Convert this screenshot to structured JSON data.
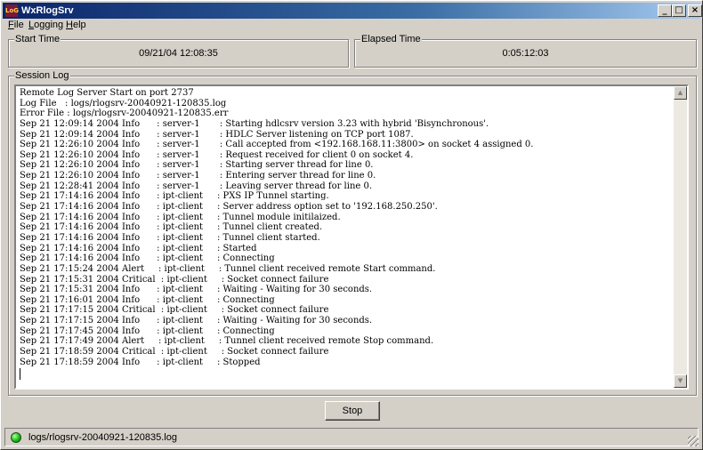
{
  "window": {
    "title": "WxRlogSrv",
    "icon_label": "LoG"
  },
  "menu": [
    {
      "label": "File",
      "mnemonic": "F",
      "rest": "ile"
    },
    {
      "label": "Logging",
      "mnemonic": "L",
      "rest": "ogging"
    },
    {
      "label": "Help",
      "mnemonic": "H",
      "rest": "elp"
    }
  ],
  "start_time": {
    "label": "Start Time",
    "value": "09/21/04 12:08:35"
  },
  "elapsed_time": {
    "label": "Elapsed Time",
    "value": "0:05:12:03"
  },
  "session_log": {
    "label": "Session Log",
    "lines": [
      "Remote Log Server Start on port 2737",
      "Log File   : logs/rlogsrv-20040921-120835.log",
      "Error File : logs/rlogsrv-20040921-120835.err",
      "Sep 21 12:09:14 2004 Info      : server-1       : Starting hdlcsrv version 3.23 with hybrid 'Bisynchronous'.",
      "Sep 21 12:09:14 2004 Info      : server-1       : HDLC Server listening on TCP port 1087.",
      "Sep 21 12:26:10 2004 Info      : server-1       : Call accepted from <192.168.168.11:3800> on socket 4 assigned 0.",
      "Sep 21 12:26:10 2004 Info      : server-1       : Request received for client 0 on socket 4.",
      "Sep 21 12:26:10 2004 Info      : server-1       : Starting server thread for line 0.",
      "Sep 21 12:26:10 2004 Info      : server-1       : Entering server thread for line 0.",
      "Sep 21 12:28:41 2004 Info      : server-1       : Leaving server thread for line 0.",
      "Sep 21 17:14:16 2004 Info      : ipt-client     : PXS IP Tunnel starting.",
      "Sep 21 17:14:16 2004 Info      : ipt-client     : Server address option set to '192.168.250.250'.",
      "Sep 21 17:14:16 2004 Info      : ipt-client     : Tunnel module initilaized.",
      "Sep 21 17:14:16 2004 Info      : ipt-client     : Tunnel client created.",
      "Sep 21 17:14:16 2004 Info      : ipt-client     : Tunnel client started.",
      "Sep 21 17:14:16 2004 Info      : ipt-client     : Started",
      "Sep 21 17:14:16 2004 Info      : ipt-client     : Connecting",
      "Sep 21 17:15:24 2004 Alert     : ipt-client     : Tunnel client received remote Start command.",
      "Sep 21 17:15:31 2004 Critical  : ipt-client     : Socket connect failure",
      "Sep 21 17:15:31 2004 Info      : ipt-client     : Waiting - Waiting for 30 seconds.",
      "Sep 21 17:16:01 2004 Info      : ipt-client     : Connecting",
      "Sep 21 17:17:15 2004 Critical  : ipt-client     : Socket connect failure",
      "Sep 21 17:17:15 2004 Info      : ipt-client     : Waiting - Waiting for 30 seconds.",
      "Sep 21 17:17:45 2004 Info      : ipt-client     : Connecting",
      "Sep 21 17:17:49 2004 Alert     : ipt-client     : Tunnel client received remote Stop command.",
      "Sep 21 17:18:59 2004 Critical  : ipt-client     : Socket connect failure",
      "Sep 21 17:18:59 2004 Info      : ipt-client     : Stopped"
    ]
  },
  "buttons": {
    "stop": "Stop"
  },
  "status": {
    "text": "logs/rlogsrv-20040921-120835.log",
    "led_color": "#10c010"
  },
  "icons": {
    "minimize": "minimize-icon",
    "maximize": "maximize-icon",
    "close": "close-icon",
    "scroll_up": "scroll-up-icon",
    "scroll_down": "scroll-down-icon",
    "status_led": "status-led-icon"
  }
}
